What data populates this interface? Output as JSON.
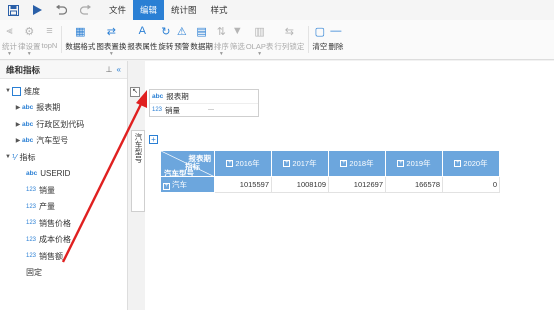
{
  "menubar": {
    "tabs": [
      {
        "label": "文件",
        "active": false
      },
      {
        "label": "编辑",
        "active": true
      },
      {
        "label": "统计图",
        "active": false
      },
      {
        "label": "样式",
        "active": false
      }
    ]
  },
  "toolbar": {
    "items": [
      {
        "label": "统计",
        "icon": "sum-icon",
        "disabled": true,
        "caret": true
      },
      {
        "label": "律设置",
        "icon": "settings-icon",
        "disabled": true,
        "caret": true
      },
      {
        "label": "topN",
        "icon": "topn-icon",
        "disabled": true,
        "caret": false
      },
      {
        "label": "数据格式",
        "icon": "format-icon",
        "disabled": false,
        "caret": false
      },
      {
        "label": "图表置换",
        "icon": "chart-swap-icon",
        "disabled": false,
        "caret": true
      },
      {
        "label": "报表属性",
        "icon": "report-props-icon",
        "disabled": false,
        "caret": false
      },
      {
        "label": "旋转",
        "icon": "rotate-icon",
        "disabled": false,
        "caret": false
      },
      {
        "label": "预警",
        "icon": "warning-icon",
        "disabled": false,
        "caret": false
      },
      {
        "label": "数据期",
        "icon": "calendar-icon",
        "disabled": false,
        "caret": false
      },
      {
        "label": "排序",
        "icon": "sort-icon",
        "disabled": true,
        "caret": true
      },
      {
        "label": "筛选",
        "icon": "filter-icon",
        "disabled": true,
        "caret": false
      },
      {
        "label": "OLAP表",
        "icon": "olap-icon",
        "disabled": true,
        "caret": true
      },
      {
        "label": "行列锁定",
        "icon": "lock-icon",
        "disabled": true,
        "caret": false
      },
      {
        "label": "清空",
        "icon": "clear-icon",
        "disabled": false,
        "caret": false
      },
      {
        "label": "删除",
        "icon": "delete-icon",
        "disabled": false,
        "caret": false
      }
    ]
  },
  "left_panel": {
    "title": "维和指标",
    "dimension_group": "维度",
    "dimensions": [
      {
        "type": "abc",
        "label": "报表期"
      },
      {
        "type": "abc",
        "label": "行政区划代码"
      },
      {
        "type": "abc",
        "label": "汽车型号"
      }
    ],
    "measure_group": "指标",
    "measures": [
      {
        "type": "abc",
        "label": "USERID"
      },
      {
        "type": "123",
        "label": "销量"
      },
      {
        "type": "123",
        "label": "产量"
      },
      {
        "type": "123",
        "label": "销售价格"
      },
      {
        "type": "123",
        "label": "成本价格"
      },
      {
        "type": "123",
        "label": "销售额"
      }
    ],
    "fixed_label": "固定"
  },
  "canvas": {
    "column_fields": [
      {
        "type": "abc",
        "label": "报表期"
      },
      {
        "type": "123",
        "label": "销量"
      }
    ],
    "row_field": "汽车型号",
    "pivot": {
      "corner": {
        "top": "报表期",
        "middle": "指标",
        "bottom": "汽车型号"
      },
      "columns": [
        "2016年",
        "2017年",
        "2018年",
        "2019年",
        "2020年"
      ],
      "rows": [
        {
          "label": "汽车",
          "values": [
            "1015597",
            "1008109",
            "1012697",
            "166578",
            "0"
          ]
        }
      ]
    }
  },
  "colors": {
    "accent": "#2a7fd4",
    "header": "#6ca6dd",
    "arrow": "#e02020"
  }
}
